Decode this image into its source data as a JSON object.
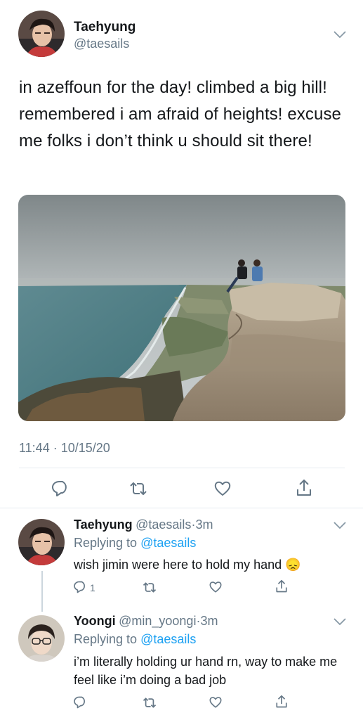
{
  "main_tweet": {
    "author_name": "Taehyung",
    "handle": "@taesails",
    "text": "in azeffoun for the day! climbed a big hill! remembered i am afraid of heights! excuse me folks i don’t think u should sit there!",
    "timestamp": "11:44 · 10/15/20"
  },
  "replies": [
    {
      "author_name": "Taehyung",
      "handle": "@taesails",
      "time": "3m",
      "replying_prefix": "Replying to",
      "replying_to": "@taesails",
      "text": "wish jimin were here to hold my hand 😞",
      "reply_count": "1"
    },
    {
      "author_name": "Yoongi",
      "handle": "@min_yoongi",
      "time": "3m",
      "replying_prefix": "Replying to",
      "replying_to": "@taesails",
      "text": "i’m literally holding ur hand rn, way to make me feel like i’m doing a bad job"
    }
  ],
  "icons": {
    "reply": "reply-icon",
    "retweet": "retweet-icon",
    "like": "like-icon",
    "share": "share-icon",
    "more": "chevron-down-icon"
  },
  "colors": {
    "text": "#14171a",
    "secondary": "#657786",
    "link": "#1da1f2",
    "divider": "#e6ecf0"
  }
}
